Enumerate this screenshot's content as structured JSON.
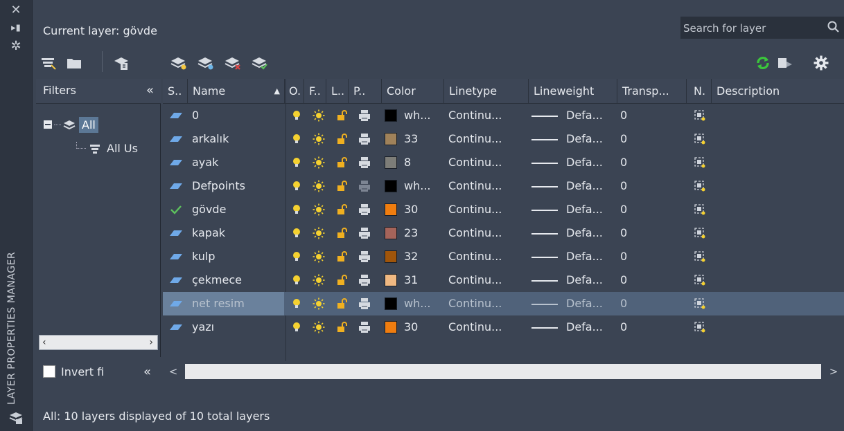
{
  "palette": {
    "title": "LAYER PROPERTIES MANAGER"
  },
  "header": {
    "current_layer": "Current layer: gövde",
    "search_placeholder": "Search for layer"
  },
  "filters": {
    "header": "Filters",
    "tree_all": "All",
    "tree_all_used": "All Us",
    "invert_label": "Invert fi"
  },
  "columns": {
    "status": "S..",
    "name": "Name",
    "on": "O.",
    "freeze": "F..",
    "lock": "L..",
    "plot": "P..",
    "color": "Color",
    "linetype": "Linetype",
    "lineweight": "Lineweight",
    "transparency": "Transp...",
    "new_vp_freeze": "N.",
    "description": "Description"
  },
  "layers": [
    {
      "name": "0",
      "status": "layer",
      "color_hex": "#000000",
      "color_name": "wh...",
      "plot_enabled": true,
      "linetype": "Continu...",
      "lineweight": "Defa...",
      "transparency": "0"
    },
    {
      "name": "arkalık",
      "status": "layer",
      "color_hex": "#a0825a",
      "color_name": "33",
      "plot_enabled": true,
      "linetype": "Continu...",
      "lineweight": "Defa...",
      "transparency": "0"
    },
    {
      "name": "ayak",
      "status": "layer",
      "color_hex": "#7d7d78",
      "color_name": "8",
      "plot_enabled": true,
      "linetype": "Continu...",
      "lineweight": "Defa...",
      "transparency": "0"
    },
    {
      "name": "Defpoints",
      "status": "layer",
      "color_hex": "#000000",
      "color_name": "wh...",
      "plot_enabled": false,
      "linetype": "Continu...",
      "lineweight": "Defa...",
      "transparency": "0"
    },
    {
      "name": "gövde",
      "status": "current",
      "color_hex": "#f07d0f",
      "color_name": "30",
      "plot_enabled": true,
      "linetype": "Continu...",
      "lineweight": "Defa...",
      "transparency": "0"
    },
    {
      "name": "kapak",
      "status": "layer",
      "color_hex": "#a5645a",
      "color_name": "23",
      "plot_enabled": true,
      "linetype": "Continu...",
      "lineweight": "Defa...",
      "transparency": "0"
    },
    {
      "name": "kulp",
      "status": "layer",
      "color_hex": "#a0550a",
      "color_name": "32",
      "plot_enabled": true,
      "linetype": "Continu...",
      "lineweight": "Defa...",
      "transparency": "0"
    },
    {
      "name": "çekmece",
      "status": "layer",
      "color_hex": "#f0b982",
      "color_name": "31",
      "plot_enabled": true,
      "linetype": "Continu...",
      "lineweight": "Defa...",
      "transparency": "0"
    },
    {
      "name": "net resim",
      "status": "layer",
      "color_hex": "#000000",
      "color_name": "wh...",
      "plot_enabled": true,
      "linetype": "Continu...",
      "lineweight": "Defa...",
      "transparency": "0",
      "selected": true
    },
    {
      "name": "yazı",
      "status": "layer",
      "color_hex": "#f07d0f",
      "color_name": "30",
      "plot_enabled": true,
      "linetype": "Continu...",
      "lineweight": "Defa...",
      "transparency": "0"
    }
  ],
  "status_bar": "All: 10 layers displayed of 10 total layers",
  "colors": {
    "panel_bg": "#3b4453",
    "strip_bg": "#2d3440",
    "selection": "#50627a",
    "bulb": "#f5d130",
    "sun": "#f5d130",
    "lock": "#f0b020",
    "refresh": "#3bc63b",
    "layer_icon": "#6fa9e8",
    "current_check": "#5dc15d"
  },
  "icons": {
    "close": "close-icon",
    "pin": "pin-icon",
    "settings": "gear-icon",
    "new_filter": "new-property-filter-icon",
    "new_group": "new-group-filter-icon",
    "states": "layer-states-manager-icon",
    "new_layer": "new-layer-icon",
    "new_vp_layer": "new-layer-vp-frozen-icon",
    "delete_layer": "delete-layer-icon",
    "set_current": "set-current-icon",
    "refresh": "refresh-icon",
    "layer_settings": "layer-settings-icon"
  }
}
